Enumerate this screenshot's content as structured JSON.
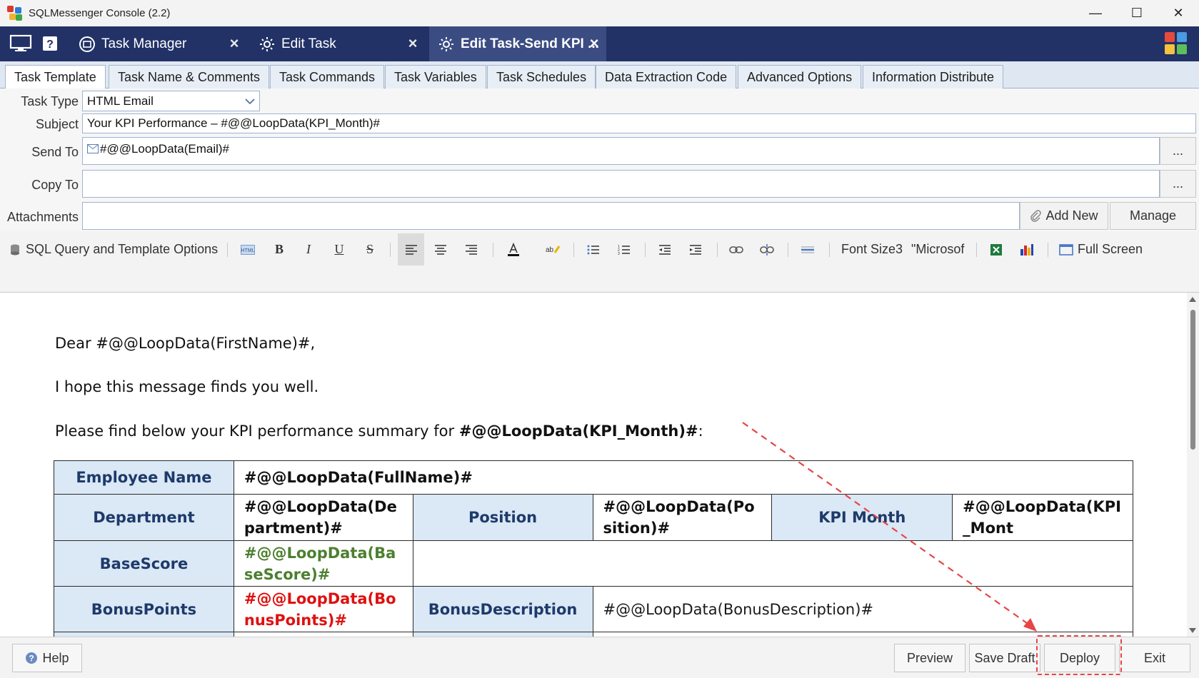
{
  "window": {
    "title": "SQLMessenger Console (2.2)",
    "minimize_glyph": "—",
    "maximize_glyph": "☐",
    "close_glyph": "✕"
  },
  "doc_tabs": [
    {
      "label": "Task Manager",
      "icon": "task-manager-icon"
    },
    {
      "label": "Edit Task",
      "icon": "gear-icon"
    },
    {
      "label": "Edit Task-Send KPI ...",
      "icon": "gear-icon",
      "active": true
    }
  ],
  "property_tabs": [
    "Task Template",
    "Task Name & Comments",
    "Task Commands",
    "Task Variables",
    "Task Schedules",
    "Data Extraction Code",
    "Advanced Options",
    "Information Distribute"
  ],
  "form": {
    "task_type_label": "Task Type",
    "task_type_value": "HTML Email",
    "subject_label": "Subject",
    "subject_value": "Your KPI Performance – #@@LoopData(KPI_Month)#",
    "send_to_label": "Send To",
    "send_to_value": "#@@LoopData(Email)#",
    "copy_to_label": "Copy To",
    "copy_to_value": "",
    "attachments_label": "Attachments",
    "ellipsis": "...",
    "add_new_label": "Add New",
    "manage_label": "Manage"
  },
  "toolbar": {
    "sql_options_label": "SQL Query and Template Options",
    "font_size_label": "Font Size3",
    "font_name_label": "\"Microsof",
    "full_screen_label": "Full Screen",
    "bold": "B",
    "italic": "I",
    "underline": "U",
    "strike": "S"
  },
  "email_body": {
    "greeting": "Dear #@@LoopData(FirstName)#,",
    "intro": "I hope this message finds you well.",
    "summary_prefix": "Please find below your KPI performance summary for ",
    "summary_var": "#@@LoopData(KPI_Month)#",
    "summary_suffix": ":",
    "table": {
      "employee_name_label": "Employee Name",
      "employee_name_value": "#@@LoopData(FullName)#",
      "department_label": "Department",
      "department_value": "#@@LoopData(Department)#",
      "position_label": "Position",
      "position_value": "#@@LoopData(Position)#",
      "kpi_month_label": "KPI Month",
      "kpi_month_value": "#@@LoopData(KPI_Mont",
      "basescore_label": "BaseScore",
      "basescore_value": "#@@LoopData(BaseScore)#",
      "bonuspoints_label": "BonusPoints",
      "bonuspoints_value": "#@@LoopData(BonusPoints)#",
      "bonusdescription_label": "BonusDescription",
      "bonusdescription_value": "#@@LoopData(BonusDescription)#"
    }
  },
  "footer": {
    "help_label": "Help",
    "preview_label": "Preview",
    "save_draft_label": "Save Draft",
    "deploy_label": "Deploy",
    "exit_label": "Exit"
  },
  "colors": {
    "tabstrip_bg": "#223166",
    "active_tab_bg": "#3b4c82",
    "table_header_bg": "#dbe8f5",
    "table_header_text": "#1d3a6a",
    "basescore_green": "#4c7f2f",
    "bonus_red": "#e01010",
    "annotation_red": "#e84545"
  }
}
